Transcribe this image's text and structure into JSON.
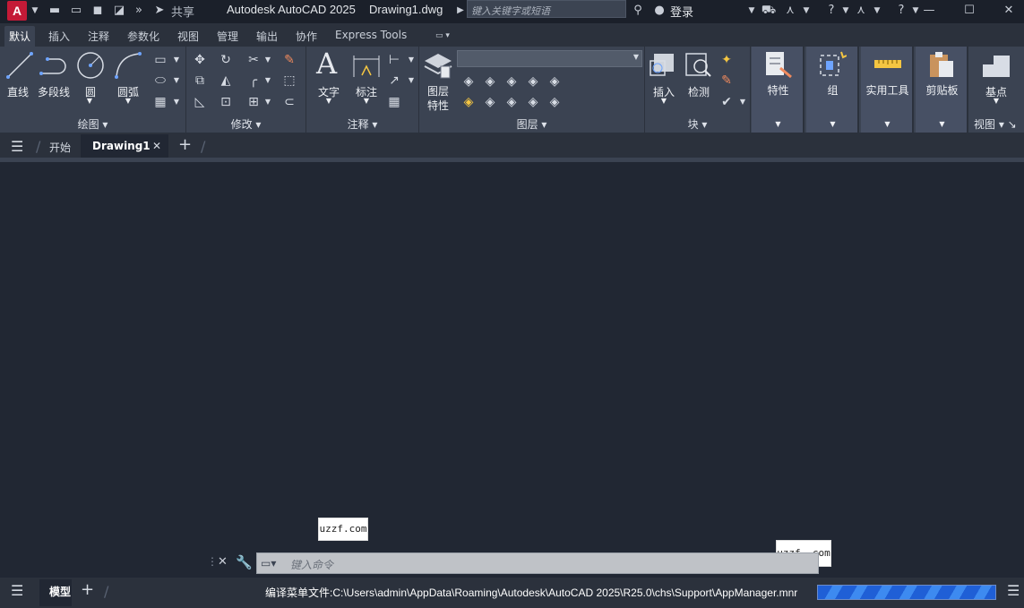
{
  "titlebar": {
    "logo": "A",
    "share_label": "共享",
    "app_title": "Autodesk AutoCAD 2025",
    "file_name": "Drawing1.dwg",
    "search_placeholder": "键入关键字或短语",
    "login_label": "登录"
  },
  "ribbon_tabs": [
    "默认",
    "插入",
    "注释",
    "参数化",
    "视图",
    "管理",
    "输出",
    "协作",
    "Express Tools"
  ],
  "ribbon": {
    "draw": {
      "title": "绘图",
      "line": "直线",
      "polyline": "多段线",
      "circle": "圆",
      "arc": "圆弧"
    },
    "modify": {
      "title": "修改"
    },
    "annotation": {
      "title": "注释",
      "text": "文字",
      "dimension": "标注"
    },
    "layers": {
      "title": "图层",
      "properties_line1": "图层",
      "properties_line2": "特性"
    },
    "block": {
      "title": "块",
      "insert": "插入",
      "inspect": "检测"
    },
    "properties": {
      "label": "特性"
    },
    "groups": {
      "label": "组"
    },
    "utilities": {
      "label": "实用工具"
    },
    "clipboard": {
      "label": "剪贴板"
    },
    "view": {
      "title": "视图",
      "base": "基点"
    }
  },
  "file_tabs": {
    "start": "开始",
    "drawing": "Drawing1"
  },
  "watermarks": {
    "left": "uzzf.com",
    "right": "uzzf. com"
  },
  "command_line": {
    "placeholder": "键入命令"
  },
  "status_bar": {
    "model_tab": "模型",
    "message": "编译菜单文件:C:\\Users\\admin\\AppData\\Roaming\\Autodesk\\AutoCAD 2025\\R25.0\\chs\\Support\\AppManager.mnr"
  },
  "colors": {
    "accent": "#c41a37",
    "progress": "#1f5fd6"
  }
}
